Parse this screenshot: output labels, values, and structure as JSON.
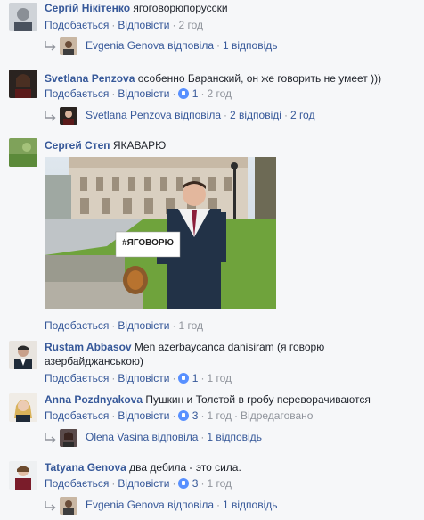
{
  "common": {
    "like_label": "Подобається",
    "reply_label": "Відповісти",
    "dot": "·"
  },
  "comments": [
    {
      "author": "Сергій Нікітенко",
      "text": "ягоговорюпорусски",
      "time": "2 год",
      "reply": {
        "name": "Evgenia Genova відповіла",
        "count": "1 відповідь",
        "time": ""
      }
    },
    {
      "author": "Svetlana Penzova",
      "text": "особенно Баранский, он же говорить не умеет )))",
      "likes": "1",
      "time": "2 год",
      "reply": {
        "name": "Svetlana Penzova відповіла",
        "count": "2 відповіді",
        "time": "2 год"
      }
    },
    {
      "author": "Сергей Степ",
      "text": "ЯКАВАРЮ",
      "photo_sign": "#ЯГОВОРЮ",
      "time": "1 год"
    },
    {
      "author": "Rustam Abbasov",
      "text": "Men azerbaycanca danisiram (я говорю",
      "text2": "азербайджанською)",
      "likes": "1",
      "time": "1 год"
    },
    {
      "author": "Anna Pozdnyakova",
      "text": "Пушкин и Толстой в гробу переворачиваются",
      "likes": "3",
      "time": "1 год",
      "edited": "Відредаговано",
      "reply": {
        "name": "Olena Vasina відповіла",
        "count": "1 відповідь",
        "time": ""
      }
    },
    {
      "author": "Tatyana Genova",
      "text": "два дебила - это сила.",
      "likes": "3",
      "time": "1 год",
      "reply": {
        "name": "Evgenia Genova відповіла",
        "count": "1 відповідь",
        "time": ""
      }
    }
  ],
  "colors": {
    "link": "#365899",
    "muted": "#90949c",
    "like": "#5890ff",
    "bg": "#f6f7f9"
  }
}
